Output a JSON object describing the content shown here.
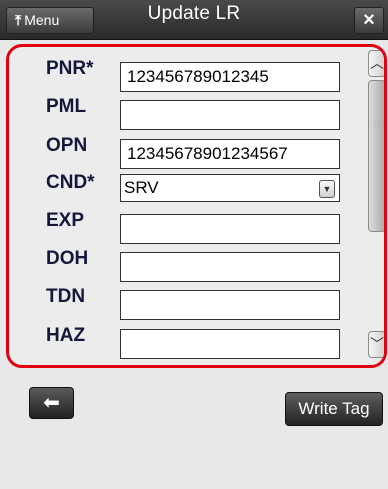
{
  "header": {
    "menu_label": "Menu",
    "title": "Update LR",
    "close_symbol": "×"
  },
  "form": {
    "fields": [
      {
        "label": "PNR*",
        "value": "123456789012345"
      },
      {
        "label": "PML",
        "value": ""
      },
      {
        "label": "OPN",
        "value": "12345678901234567"
      },
      {
        "label": "CND*",
        "value": "SRV"
      },
      {
        "label": "EXP",
        "value": ""
      },
      {
        "label": "DOH",
        "value": ""
      },
      {
        "label": "TDN",
        "value": ""
      },
      {
        "label": "HAZ",
        "value": ""
      }
    ]
  },
  "footer": {
    "write_tag_label": "Write Tag"
  },
  "colors": {
    "highlight_border": "#e0000e",
    "label_color": "#15183a"
  }
}
